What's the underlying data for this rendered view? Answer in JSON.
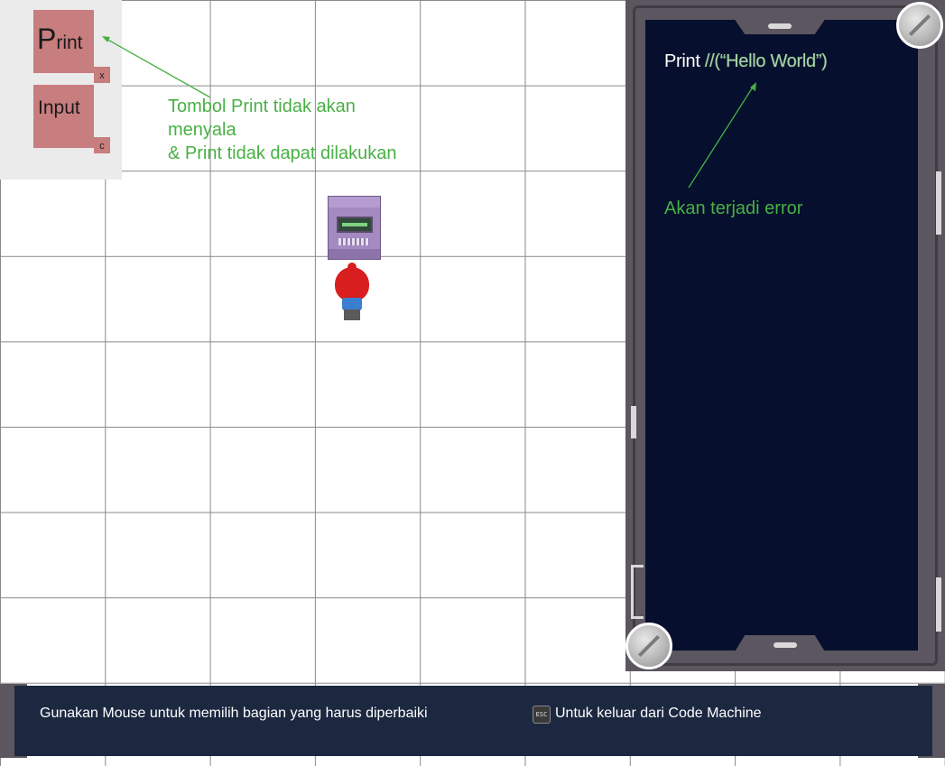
{
  "palette": {
    "print": {
      "label_initial": "P",
      "label_rest": "rint",
      "shortcut": "x"
    },
    "input": {
      "label": "Input",
      "shortcut": "c"
    }
  },
  "annotations": {
    "print_disabled": [
      "Tombol Print tidak akan",
      "menyala",
      "& Print tidak dapat dilakukan"
    ],
    "error": "Akan terjadi error"
  },
  "code_machine": {
    "code_keyword": "Print",
    "code_rest": " //(“Hello World”)"
  },
  "footer": {
    "mouse_hint": "Gunakan Mouse untuk memilih bagian yang harus diperbaiki",
    "esc_key": "ESC",
    "esc_hint": "Untuk keluar dari Code Machine"
  },
  "colors": {
    "annotation": "#48b043",
    "command_button": "#c87d7e",
    "screen": "#060f2d",
    "machine_frame": "#5b5660",
    "footer_bar": "#1c2840"
  },
  "icons": {
    "terminal": "computer-terminal-icon",
    "player": "player-character-icon",
    "esc": "esc-key-icon"
  }
}
